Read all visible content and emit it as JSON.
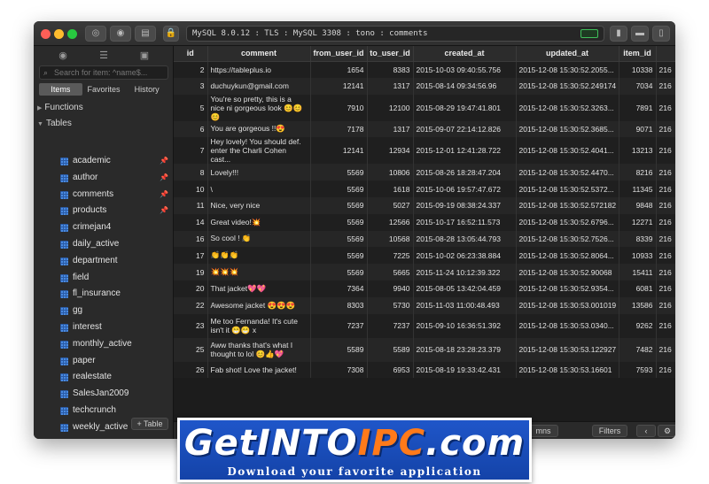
{
  "titlebar": {
    "connection": "MySQL 8.0.12 : TLS : MySQL 3308 : tono : comments",
    "lock_icon": "lock-icon"
  },
  "sidebar": {
    "search_placeholder": "Search for item: ^name$...",
    "tabs": [
      "Items",
      "Favorites",
      "History"
    ],
    "active_tab": "Items",
    "groups": {
      "functions": "Functions",
      "tables": "Tables"
    },
    "tables": [
      {
        "name": "academic",
        "pinned": true
      },
      {
        "name": "author",
        "pinned": true
      },
      {
        "name": "comments",
        "pinned": true
      },
      {
        "name": "products",
        "pinned": true
      },
      {
        "name": "crimejan4",
        "pinned": false
      },
      {
        "name": "daily_active",
        "pinned": false
      },
      {
        "name": "department",
        "pinned": false
      },
      {
        "name": "field",
        "pinned": false
      },
      {
        "name": "fl_insurance",
        "pinned": false
      },
      {
        "name": "gg",
        "pinned": false
      },
      {
        "name": "interest",
        "pinned": false
      },
      {
        "name": "monthly_active",
        "pinned": false
      },
      {
        "name": "paper",
        "pinned": false
      },
      {
        "name": "realestate",
        "pinned": false
      },
      {
        "name": "SalesJan2009",
        "pinned": false
      },
      {
        "name": "techcrunch",
        "pinned": false
      },
      {
        "name": "weekly_active",
        "pinned": false
      }
    ],
    "add_table_label": "+ Table"
  },
  "grid": {
    "columns": [
      "id",
      "comment",
      "from_user_id",
      "to_user_id",
      "created_at",
      "updated_at",
      "item_id",
      ""
    ],
    "rows": [
      {
        "id": "2",
        "comment": "https://tableplus.io",
        "from": "1654",
        "to": "8383",
        "created": "2015-10-03 09:40:55.756",
        "updated": "2015-12-08 15:30:52.2055...",
        "item": "10338",
        "extra": "216"
      },
      {
        "id": "3",
        "comment": "duchuykun@gmail.com",
        "from": "12141",
        "to": "1317",
        "created": "2015-08-14 09:34:56.96",
        "updated": "2015-12-08 15:30:52.249174",
        "item": "7034",
        "extra": "216"
      },
      {
        "id": "5",
        "comment": "You're so pretty, this is a nice ni gorgeous look 😊😊😊",
        "from": "7910",
        "to": "12100",
        "created": "2015-08-29 19:47:41.801",
        "updated": "2015-12-08 15:30:52.3263...",
        "item": "7891",
        "extra": "216"
      },
      {
        "id": "6",
        "comment": "You are gorgeous !!😍",
        "from": "7178",
        "to": "1317",
        "created": "2015-09-07 22:14:12.826",
        "updated": "2015-12-08 15:30:52.3685...",
        "item": "9071",
        "extra": "216"
      },
      {
        "id": "7",
        "comment": "Hey lovely! You should def. enter the Charli Cohen cast...",
        "from": "12141",
        "to": "12934",
        "created": "2015-12-01 12:41:28.722",
        "updated": "2015-12-08 15:30:52.4041...",
        "item": "13213",
        "extra": "216"
      },
      {
        "id": "8",
        "comment": "Lovely!!!",
        "from": "5569",
        "to": "10806",
        "created": "2015-08-26 18:28:47.204",
        "updated": "2015-12-08 15:30:52.4470...",
        "item": "8216",
        "extra": "216"
      },
      {
        "id": "10",
        "comment": "\\",
        "from": "5569",
        "to": "1618",
        "created": "2015-10-06 19:57:47.672",
        "updated": "2015-12-08 15:30:52.5372...",
        "item": "11345",
        "extra": "216"
      },
      {
        "id": "11",
        "comment": "Nice, very nice",
        "from": "5569",
        "to": "5027",
        "created": "2015-09-19 08:38:24.337",
        "updated": "2015-12-08 15:30:52.572182",
        "item": "9848",
        "extra": "216"
      },
      {
        "id": "14",
        "comment": "Great video!💥",
        "from": "5569",
        "to": "12566",
        "created": "2015-10-17 16:52:11.573",
        "updated": "2015-12-08 15:30:52.6796...",
        "item": "12271",
        "extra": "216"
      },
      {
        "id": "16",
        "comment": "So cool ! 👏",
        "from": "5569",
        "to": "10568",
        "created": "2015-08-28 13:05:44.793",
        "updated": "2015-12-08 15:30:52.7526...",
        "item": "8339",
        "extra": "216"
      },
      {
        "id": "17",
        "comment": "👏👏👏",
        "from": "5569",
        "to": "7225",
        "created": "2015-10-02 06:23:38.884",
        "updated": "2015-12-08 15:30:52.8064...",
        "item": "10933",
        "extra": "216"
      },
      {
        "id": "19",
        "comment": "💥💥💥",
        "from": "5569",
        "to": "5665",
        "created": "2015-11-24 10:12:39.322",
        "updated": "2015-12-08 15:30:52.90068",
        "item": "15411",
        "extra": "216"
      },
      {
        "id": "20",
        "comment": "That jacket💖💖",
        "from": "7364",
        "to": "9940",
        "created": "2015-08-05 13:42:04.459",
        "updated": "2015-12-08 15:30:52.9354...",
        "item": "6081",
        "extra": "216"
      },
      {
        "id": "22",
        "comment": "Awesome jacket 😍😍😍",
        "from": "8303",
        "to": "5730",
        "created": "2015-11-03 11:00:48.493",
        "updated": "2015-12-08 15:30:53.001019",
        "item": "13586",
        "extra": "216"
      },
      {
        "id": "23",
        "comment": "Me too Fernanda! It's cute isn't it 😁😁 x",
        "from": "7237",
        "to": "7237",
        "created": "2015-09-10 16:36:51.392",
        "updated": "2015-12-08 15:30:53.0340...",
        "item": "9262",
        "extra": "216"
      },
      {
        "id": "25",
        "comment": "Aww thanks that's what I thought to lol 😊👍💖",
        "from": "5589",
        "to": "5589",
        "created": "2015-08-18 23:28:23.379",
        "updated": "2015-12-08 15:30:53.122927",
        "item": "7482",
        "extra": "216"
      },
      {
        "id": "26",
        "comment": "Fab shot! Love the jacket!",
        "from": "7308",
        "to": "6953",
        "created": "2015-08-19 19:33:42.431",
        "updated": "2015-12-08 15:30:53.16601",
        "item": "7593",
        "extra": "216"
      }
    ],
    "tall_rows": [
      2,
      4,
      14,
      15
    ]
  },
  "bottombar": {
    "columns_label": "mns",
    "filters_label": "Filters",
    "prev_icon": "chevron-left-icon",
    "settings_icon": "gear-icon",
    "next_icon": "chevron-right-icon"
  },
  "watermark": {
    "title_part1": "GetINTO",
    "title_part2": "IPC",
    "title_part3": ".com",
    "subtitle": "Download your favorite application"
  },
  "colors": {
    "background": "#1e1e1e",
    "sidebar": "#2a2a2a",
    "table_icon": "#4a8be0",
    "pin": "#e89a3c",
    "watermark_blue": "#1f56c9",
    "watermark_accent": "#ff7a1a"
  }
}
